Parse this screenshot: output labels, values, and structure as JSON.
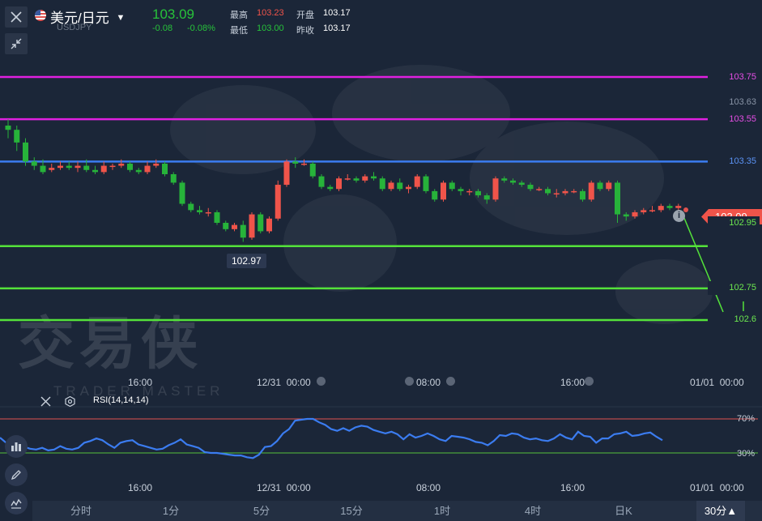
{
  "header": {
    "pair_name": "美元/日元",
    "symbol_code": "USDJPY",
    "last_price": "103.09",
    "change": "-0.08",
    "change_pct": "-0.08%",
    "high_label": "最高",
    "high_value": "103.23",
    "low_label": "最低",
    "low_value": "103.00",
    "open_label": "开盘",
    "open_value": "103.17",
    "prev_close_label": "昨收",
    "prev_close_value": "103.17"
  },
  "watermark": {
    "brand": "交易侠",
    "brand_en": "TRADER MASTER"
  },
  "price_levels": [
    {
      "value": "103.75",
      "color": "#e020e0"
    },
    {
      "value": "103.55",
      "color": "#e020e0"
    },
    {
      "value": "103.35",
      "color": "#3b7cf0"
    },
    {
      "value": "102.95",
      "color": "#54e23a"
    },
    {
      "value": "102.75",
      "color": "#54e23a"
    },
    {
      "value": "102.6",
      "color": "#54e23a"
    }
  ],
  "axis_label_top": "103.63",
  "current_price_tag": "103.09",
  "min_marker": "102.97",
  "time_axis": [
    "16:00",
    "12/31  00:00",
    "08:00",
    "16:00",
    "01/01  00:00"
  ],
  "rsi": {
    "label": "RSI(14,14,14)",
    "upper": "70%",
    "lower": "30%",
    "upper_color": "#e0524f",
    "lower_color": "#54c23a",
    "line_color": "#3b7cf0"
  },
  "timeframes": [
    "分时",
    "1分",
    "5分",
    "15分",
    "1时",
    "4时",
    "日K",
    "30分▲"
  ],
  "colors": {
    "up": "#f0544a",
    "down": "#27b33a",
    "bg": "#1b2638"
  },
  "chart_data": {
    "type": "candlestick",
    "title": "美元/日元",
    "xlabel": "",
    "ylabel": "",
    "ylim": [
      102.55,
      103.8
    ],
    "candles": [
      [
        103.52,
        103.5,
        103.55,
        103.46
      ],
      [
        103.5,
        103.44,
        103.52,
        103.4
      ],
      [
        103.44,
        103.35,
        103.46,
        103.33
      ],
      [
        103.35,
        103.33,
        103.37,
        103.31
      ],
      [
        103.33,
        103.3,
        103.36,
        103.29
      ],
      [
        103.31,
        103.32,
        103.34,
        103.3
      ],
      [
        103.32,
        103.33,
        103.35,
        103.31
      ],
      [
        103.33,
        103.32,
        103.35,
        103.31
      ],
      [
        103.32,
        103.33,
        103.35,
        103.3
      ],
      [
        103.33,
        103.31,
        103.36,
        103.3
      ],
      [
        103.31,
        103.3,
        103.33,
        103.29
      ],
      [
        103.3,
        103.33,
        103.35,
        103.29
      ],
      [
        103.33,
        103.33,
        103.34,
        103.31
      ],
      [
        103.33,
        103.34,
        103.36,
        103.32
      ],
      [
        103.34,
        103.31,
        103.35,
        103.3
      ],
      [
        103.31,
        103.3,
        103.32,
        103.29
      ],
      [
        103.3,
        103.33,
        103.35,
        103.29
      ],
      [
        103.33,
        103.34,
        103.36,
        103.32
      ],
      [
        103.34,
        103.29,
        103.35,
        103.28
      ],
      [
        103.29,
        103.25,
        103.3,
        103.24
      ],
      [
        103.25,
        103.15,
        103.26,
        103.14
      ],
      [
        103.15,
        103.12,
        103.16,
        103.11
      ],
      [
        103.12,
        103.11,
        103.14,
        103.1
      ],
      [
        103.11,
        103.11,
        103.13,
        103.09
      ],
      [
        103.11,
        103.06,
        103.12,
        103.05
      ],
      [
        103.06,
        103.03,
        103.07,
        103.02
      ],
      [
        103.03,
        103.05,
        103.06,
        103.02
      ],
      [
        103.05,
        102.99,
        103.07,
        102.97
      ],
      [
        102.99,
        103.1,
        103.11,
        102.98
      ],
      [
        103.1,
        103.02,
        103.11,
        103.01
      ],
      [
        103.02,
        103.08,
        103.09,
        103.01
      ],
      [
        103.08,
        103.24,
        103.26,
        103.07
      ],
      [
        103.24,
        103.35,
        103.36,
        103.23
      ],
      [
        103.35,
        103.34,
        103.37,
        103.32
      ],
      [
        103.34,
        103.34,
        103.36,
        103.33
      ],
      [
        103.34,
        103.28,
        103.35,
        103.27
      ],
      [
        103.28,
        103.23,
        103.29,
        103.22
      ],
      [
        103.23,
        103.22,
        103.24,
        103.21
      ],
      [
        103.22,
        103.27,
        103.28,
        103.21
      ],
      [
        103.27,
        103.27,
        103.29,
        103.26
      ],
      [
        103.27,
        103.26,
        103.28,
        103.25
      ],
      [
        103.26,
        103.28,
        103.29,
        103.25
      ],
      [
        103.28,
        103.27,
        103.3,
        103.26
      ],
      [
        103.27,
        103.22,
        103.28,
        103.21
      ],
      [
        103.22,
        103.25,
        103.26,
        103.21
      ],
      [
        103.25,
        103.22,
        103.27,
        103.21
      ],
      [
        103.22,
        103.23,
        103.24,
        103.2
      ],
      [
        103.23,
        103.28,
        103.29,
        103.22
      ],
      [
        103.28,
        103.21,
        103.29,
        103.2
      ],
      [
        103.21,
        103.17,
        103.22,
        103.16
      ],
      [
        103.17,
        103.25,
        103.26,
        103.16
      ],
      [
        103.25,
        103.22,
        103.26,
        103.21
      ],
      [
        103.22,
        103.21,
        103.23,
        103.19
      ],
      [
        103.21,
        103.21,
        103.22,
        103.19
      ],
      [
        103.21,
        103.19,
        103.22,
        103.18
      ],
      [
        103.19,
        103.17,
        103.2,
        103.15
      ],
      [
        103.17,
        103.27,
        103.28,
        103.16
      ],
      [
        103.27,
        103.26,
        103.28,
        103.25
      ],
      [
        103.26,
        103.25,
        103.27,
        103.24
      ],
      [
        103.25,
        103.24,
        103.26,
        103.23
      ],
      [
        103.24,
        103.22,
        103.25,
        103.21
      ],
      [
        103.22,
        103.22,
        103.23,
        103.21
      ],
      [
        103.22,
        103.2,
        103.23,
        103.19
      ],
      [
        103.2,
        103.2,
        103.22,
        103.18
      ],
      [
        103.2,
        103.21,
        103.22,
        103.19
      ],
      [
        103.21,
        103.21,
        103.22,
        103.2
      ],
      [
        103.21,
        103.17,
        103.22,
        103.16
      ],
      [
        103.17,
        103.25,
        103.26,
        103.16
      ],
      [
        103.25,
        103.22,
        103.26,
        103.21
      ],
      [
        103.22,
        103.25,
        103.26,
        103.21
      ],
      [
        103.25,
        103.1,
        103.26,
        103.06
      ],
      [
        103.1,
        103.09,
        103.11,
        103.07
      ],
      [
        103.09,
        103.11,
        103.12,
        103.08
      ],
      [
        103.11,
        103.12,
        103.13,
        103.1
      ],
      [
        103.12,
        103.12,
        103.14,
        103.11
      ],
      [
        103.12,
        103.14,
        103.15,
        103.11
      ],
      [
        103.14,
        103.13,
        103.15,
        103.12
      ],
      [
        103.13,
        103.14,
        103.15,
        103.12
      ]
    ],
    "candle_fields": [
      "open",
      "close",
      "high",
      "low"
    ],
    "rsi_values": [
      48,
      42,
      38,
      40,
      37,
      35,
      34,
      36,
      33,
      34,
      38,
      35,
      34,
      36,
      42,
      44,
      47,
      45,
      40,
      36,
      42,
      44,
      45,
      40,
      38,
      36,
      34,
      35,
      39,
      42,
      46,
      40,
      38,
      36,
      31,
      30,
      30,
      29,
      28,
      27,
      27,
      25,
      24,
      28,
      37,
      38,
      44,
      53,
      58,
      68,
      69,
      70,
      70,
      66,
      63,
      58,
      56,
      59,
      56,
      60,
      62,
      61,
      57,
      55,
      53,
      55,
      52,
      46,
      52,
      48,
      50,
      53,
      50,
      46,
      44,
      50,
      49,
      48,
      46,
      43,
      42,
      39,
      44,
      51,
      50,
      53,
      52,
      48,
      46,
      47,
      45,
      44,
      47,
      52,
      48,
      46,
      55,
      50,
      49,
      42,
      47,
      47,
      52,
      53,
      55,
      50,
      51,
      53,
      54,
      49,
      45
    ]
  }
}
